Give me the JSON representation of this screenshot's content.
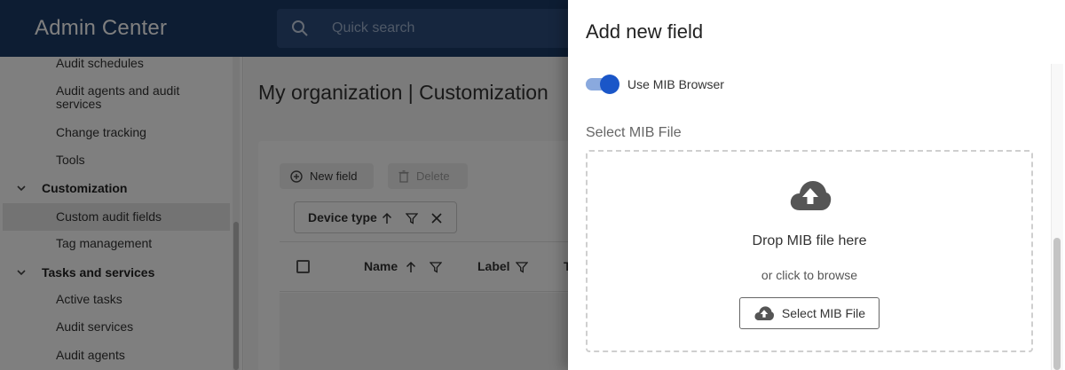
{
  "app": {
    "title": "Admin Center",
    "search_placeholder": "Quick search"
  },
  "sidebar": {
    "items": [
      {
        "label": "Audit schedules"
      },
      {
        "label": "Audit agents and audit services"
      },
      {
        "label": "Change tracking"
      },
      {
        "label": "Tools"
      }
    ],
    "customization": {
      "label": "Customization",
      "items": [
        {
          "label": "Custom audit fields",
          "selected": true
        },
        {
          "label": "Tag management"
        }
      ]
    },
    "tasks": {
      "label": "Tasks and services",
      "items": [
        {
          "label": "Active tasks"
        },
        {
          "label": "Audit services"
        },
        {
          "label": "Audit agents"
        }
      ]
    }
  },
  "main": {
    "page_title": "My organization | Customization",
    "toolbar": {
      "new_field": "New field",
      "delete": "Delete"
    },
    "group_chip": "Device type",
    "columns": [
      "Name",
      "Label",
      "T"
    ]
  },
  "drawer": {
    "title": "Add new field",
    "toggle_label": "Use MIB Browser",
    "toggle_on": true,
    "select_label": "Select MIB File",
    "drop_text": "Drop MIB file here",
    "browse_text": "or click to browse",
    "select_button": "Select MIB File"
  },
  "colors": {
    "topbar": "#1a3a66",
    "accent": "#1a56c8",
    "overlay": "rgba(0,0,0,0.5)"
  }
}
